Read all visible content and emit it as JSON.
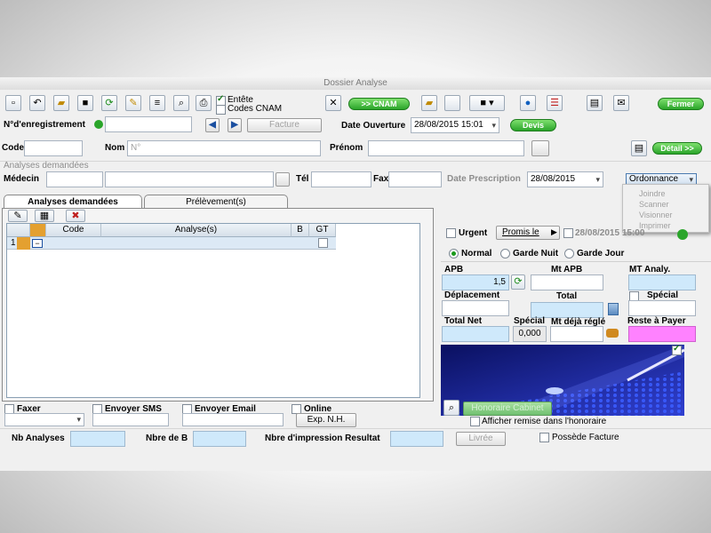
{
  "window": {
    "title": "Dossier Analyse"
  },
  "toolbar": {
    "entete_label": "Entête",
    "codes_cnam_label": "Codes CNAM",
    "cnam_button": ">> CNAM",
    "fermer_button": "Fermer"
  },
  "record": {
    "no_enregistrement_label": "N°d'enregistrement",
    "facture_button": "Facture",
    "date_ouverture_label": "Date Ouverture",
    "date_ouverture_value": "28/08/2015 15:01",
    "devis_button": "Devis"
  },
  "patient": {
    "code_label": "Code",
    "nom_label": "Nom",
    "nom_hint": "N°",
    "prenom_label": "Prénom",
    "detail_button": "Détail >>"
  },
  "analyses_section": {
    "title": "Analyses demandées",
    "medecin_label": "Médecin",
    "tel_label": "Tél",
    "fax_label": "Fax",
    "date_prescription_label": "Date Prescription",
    "date_prescription_value": "28/08/2015",
    "ordonnance_label": "Ordonnance"
  },
  "ordonnance_menu": [
    "Joindre",
    "Scanner",
    "Visionner",
    "Imprimer"
  ],
  "tabs": [
    "Analyses demandées",
    "Prélèvement(s)"
  ],
  "grid": {
    "headers": [
      "Code",
      "Analyse(s)",
      "B",
      "GT"
    ],
    "row_number": "1"
  },
  "options": {
    "urgent_label": "Urgent",
    "promis_le_button": "Promis le",
    "promis_date": "28/08/2015 15:00",
    "normal_label": "Normal",
    "garde_nuit_label": "Garde Nuit",
    "garde_jour_label": "Garde Jour"
  },
  "amounts": {
    "apb_label": "APB",
    "apb_value": "1,5",
    "mt_apb_label": "Mt APB",
    "mt_analy_label": "MT Analy.",
    "deplacement_label": "Déplacement",
    "total_label": "Total",
    "special_label_1": "Spécial",
    "total_net_label": "Total Net",
    "special_label_2": "Spécial",
    "special_value": "0,000",
    "mt_deja_regle_label": "Mt déjà réglé",
    "reste_a_payer_label": "Reste à Payer"
  },
  "photo_overlay_button": "Honoraire Cabinet",
  "afficher_remise_label": "Afficher remise dans l'honoraire",
  "bottom": {
    "faxer_label": "Faxer",
    "envoyer_sms_label": "Envoyer SMS",
    "envoyer_email_label": "Envoyer Email",
    "online_label": "Online",
    "exp_nh_button": "Exp. N.H.",
    "nb_analyses_label": "Nb Analyses",
    "nbre_de_b_label": "Nbre de B",
    "nbre_impression_label": "Nbre d'impression Resultat",
    "livree_button": "Livrée",
    "possede_facture_label": "Possède Facture"
  },
  "colors": {
    "accent_green": "#2aa52a",
    "field_blue": "#cfe9fb",
    "field_pink": "#ff82ff"
  }
}
